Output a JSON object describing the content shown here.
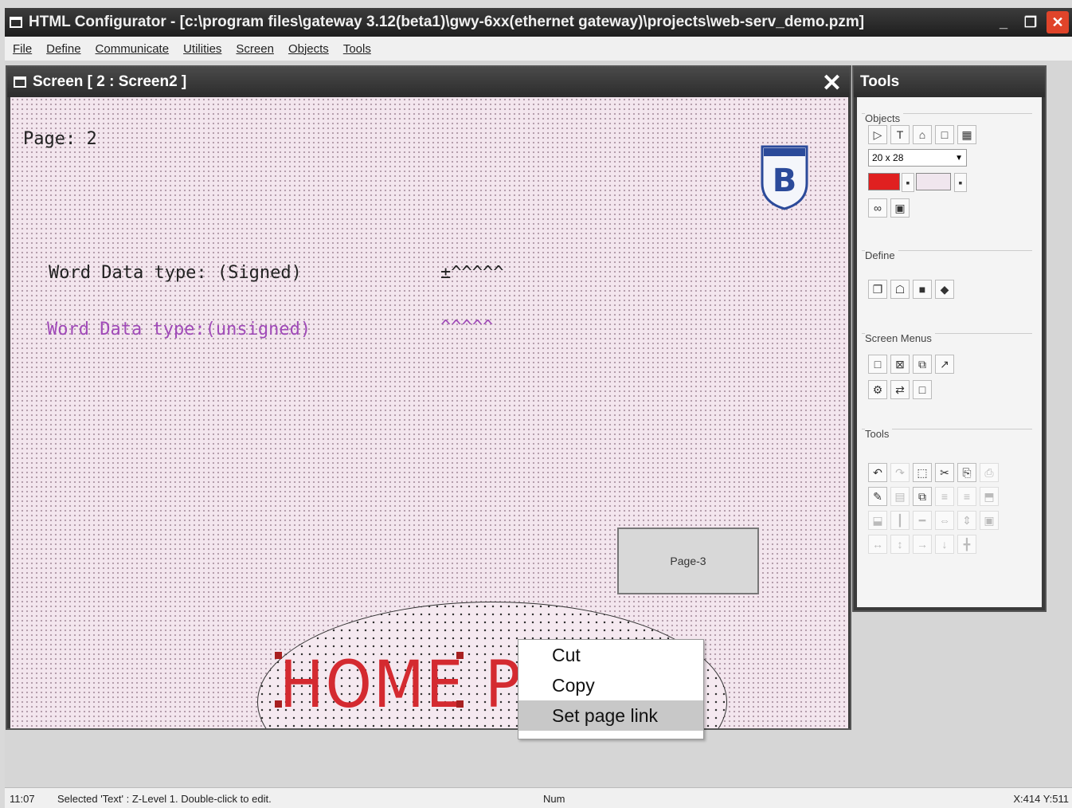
{
  "window": {
    "title": "HTML Configurator - [c:\\program files\\gateway 3.12(beta1)\\gwy-6xx(ethernet gateway)\\projects\\web-serv_demo.pzm]",
    "min_glyph": "_",
    "max_glyph": "❐",
    "close_glyph": "✕"
  },
  "menubar": [
    "File",
    "Define",
    "Communicate",
    "Utilities",
    "Screen",
    "Objects",
    "Tools"
  ],
  "screen_window": {
    "title": "Screen [ 2 : Screen2 ]",
    "close_glyph": "✕"
  },
  "canvas": {
    "page_label": "Page: 2",
    "word_signed_label": "Word Data type: (Signed)",
    "signed_mask": "±^^^^^",
    "word_unsigned_label": "Word Data type:(unsigned)",
    "unsigned_mask": "^^^^^",
    "page3_button": "Page-3",
    "home_page_text": "HOME PAGE",
    "logo_text": "B"
  },
  "context_menu": {
    "items": [
      {
        "label": "Cut",
        "highlighted": false
      },
      {
        "label": "Copy",
        "highlighted": false
      },
      {
        "label": "Set page link",
        "highlighted": true
      }
    ]
  },
  "tools_panel": {
    "title": "Tools",
    "groups": {
      "objects": "Objects",
      "define": "Define",
      "screen_menus": "Screen Menus",
      "tools": "Tools"
    },
    "font_size_value": "20 x 28",
    "fg_color": "#e02020",
    "bg_color": "#f0e6ee"
  },
  "statusbar": {
    "time": "11:07",
    "message": "Selected 'Text' : Z-Level 1. Double-click to edit.",
    "num": "Num",
    "coords": "X:414 Y:511"
  },
  "colors": {
    "accent_red": "#d42a30",
    "purple_text": "#a04ab8"
  }
}
